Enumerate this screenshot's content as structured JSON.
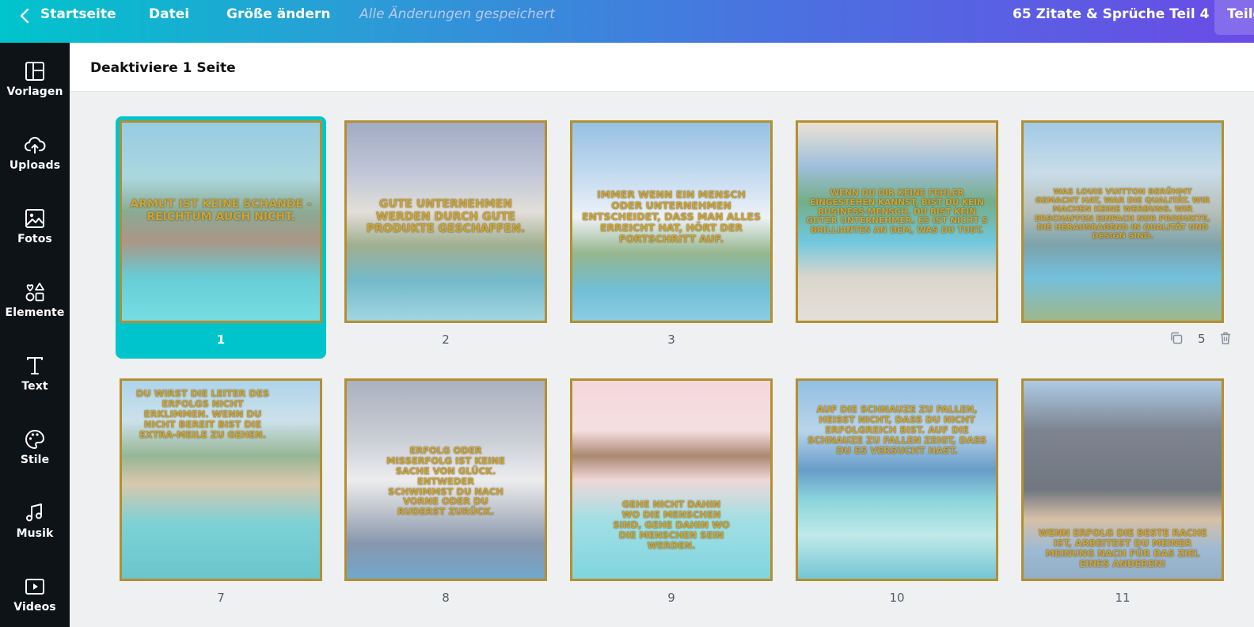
{
  "topbar": {
    "home": "Startseite",
    "file": "Datei",
    "resize": "Größe ändern",
    "saved_status": "Alle Änderungen gespeichert",
    "design_title": "65 Zitate & Sprüche Teil 4",
    "share": "Teilen"
  },
  "sidebar": {
    "items": [
      {
        "label": "Vorlagen",
        "icon": "layout-icon"
      },
      {
        "label": "Uploads",
        "icon": "cloud-upload-icon"
      },
      {
        "label": "Fotos",
        "icon": "image-icon"
      },
      {
        "label": "Elemente",
        "icon": "shapes-icon"
      },
      {
        "label": "Text",
        "icon": "text-icon"
      },
      {
        "label": "Stile",
        "icon": "palette-icon"
      },
      {
        "label": "Musik",
        "icon": "music-icon"
      },
      {
        "label": "Videos",
        "icon": "video-icon"
      }
    ]
  },
  "subheader": {
    "label": "Deaktiviere 1 Seite"
  },
  "colors": {
    "accent": "#00c4cc",
    "frame": "#b38f2f",
    "quote_text": "#c9a43a",
    "rail": "#0e1318"
  },
  "pages": [
    {
      "number": "1",
      "quote": "Armut ist keine Schande - Reichtum auch nicht.",
      "selected": true
    },
    {
      "number": "2",
      "quote": "Gute Unternehmen werden durch gute Produkte geschaffen."
    },
    {
      "number": "3",
      "quote": "Immer wenn ein Mensch oder Unternehmen entscheidet, dass man alles erreicht hat, hört der Fortschritt auf."
    },
    {
      "number": "",
      "quote": "Wenn du dir keine Fehler eingestehen kannst, bist du kein Business-Mensch. Du bist kein guter Unternehmer. Es ist nicht s brilliantes an dem, was du tust."
    },
    {
      "number": "5",
      "quote": "Was Louis Vuitton berühmt gemacht hat, war die Qualität. Wir machen keine Werbung. Wir erschaffen einfach nur Produkte, die herausragend in Qualität und Design sind."
    },
    {
      "number": "7",
      "quote": "Du wirst die Leiter des Erfolgs nicht erklimmen. Wenn du nicht bereit bist die Extra-Meile zu gehen."
    },
    {
      "number": "8",
      "quote": "Erfolg oder Misserfolg ist keine Sache von Glück. Entweder schwimmst du nach vorne oder du ruderst zurück."
    },
    {
      "number": "9",
      "quote": "Gehe nicht dahin wo die Menschen sind, gehe dahin wo die Menschen sein werden."
    },
    {
      "number": "10",
      "quote": "Auf die Schnauze zu fallen, heisst nicht, dass du nicht erfolgreich bist. Auf die Schnauze zu fallen zeigt, dass du es versucht hast."
    },
    {
      "number": "11",
      "quote": "Wenn Erfolg die beste Rache ist, arbeitest du meiner Meinung nach für das Ziel eines anderen!"
    }
  ]
}
